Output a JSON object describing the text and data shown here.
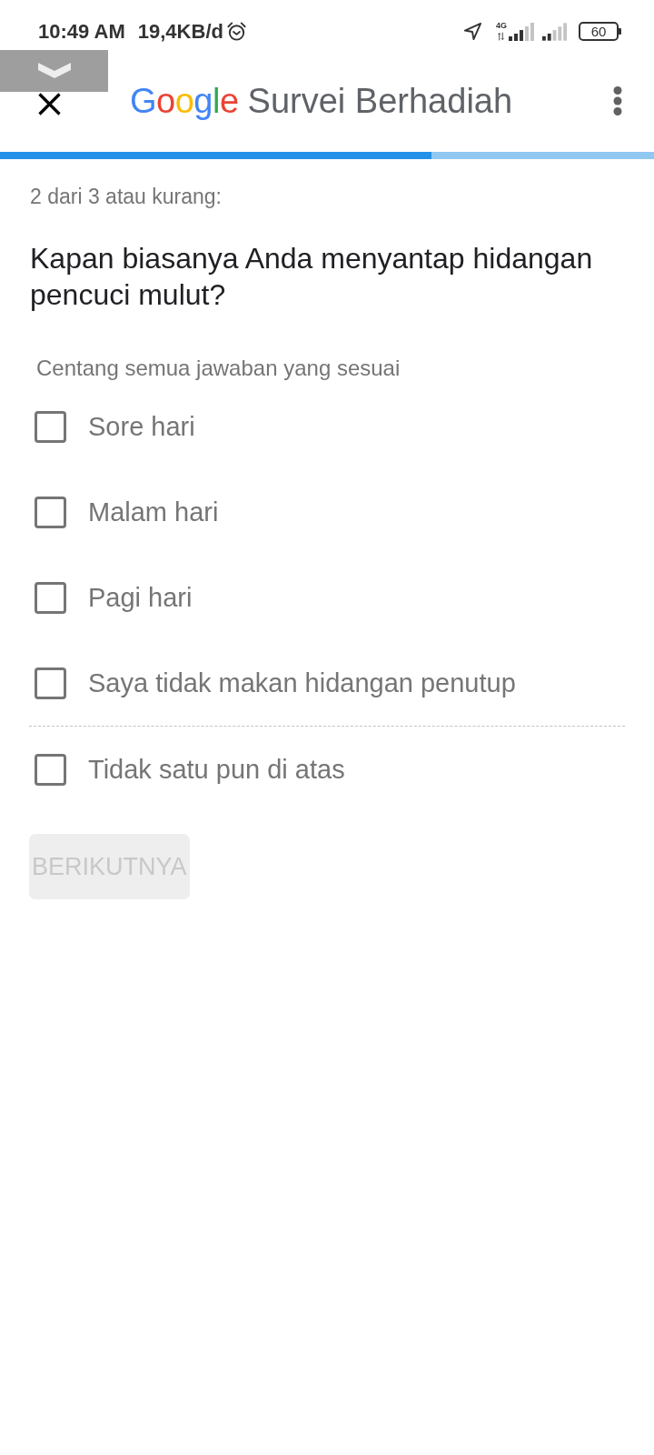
{
  "status_bar": {
    "time": "10:49 AM",
    "data_speed": "19,4KB/d",
    "network_type": "4G",
    "battery": "60"
  },
  "app_bar": {
    "logo": "Google",
    "title": "Survei Berhadiah"
  },
  "progress": {
    "level": 0.66
  },
  "survey": {
    "step": "2 dari 3 atau kurang:",
    "question": "Kapan biasanya Anda menyantap hidangan pencuci mulut?",
    "instruction": "Centang semua jawaban yang sesuai",
    "options": [
      {
        "label": "Sore hari",
        "checked": false,
        "kind": "answer"
      },
      {
        "label": "Malam hari",
        "checked": false,
        "kind": "answer"
      },
      {
        "label": "Pagi hari",
        "checked": false,
        "kind": "answer"
      },
      {
        "label": "Saya tidak makan hidangan penutup",
        "checked": false,
        "kind": "answer"
      },
      {
        "label": "Tidak satu pun di atas",
        "checked": false,
        "kind": "exclusive"
      }
    ]
  },
  "next_button": {
    "label": "BERIKUTNYA",
    "disabled": true
  }
}
